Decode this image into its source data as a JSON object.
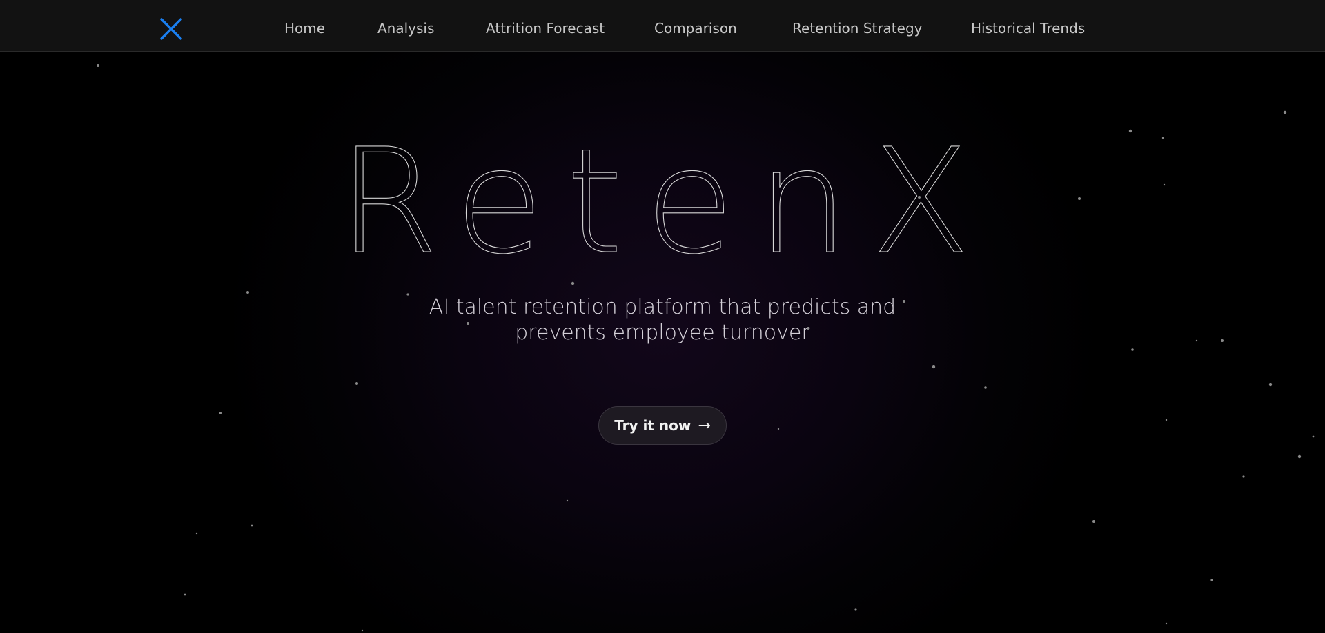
{
  "nav": {
    "logo_icon": "x-logo-icon",
    "accent_color": "#1a7ff0",
    "items": [
      {
        "label": "Home"
      },
      {
        "label": "Analysis"
      },
      {
        "label": "Attrition Forecast"
      },
      {
        "label": "Comparison"
      },
      {
        "label": "Retention Strategy"
      },
      {
        "label": "Historical Trends"
      }
    ]
  },
  "hero": {
    "title": "RetenX",
    "subtitle_line1": "AI talent retention platform that predicts and",
    "subtitle_line2": "prevents employee turnover",
    "cta_label": "Try it now",
    "cta_icon": "→"
  }
}
